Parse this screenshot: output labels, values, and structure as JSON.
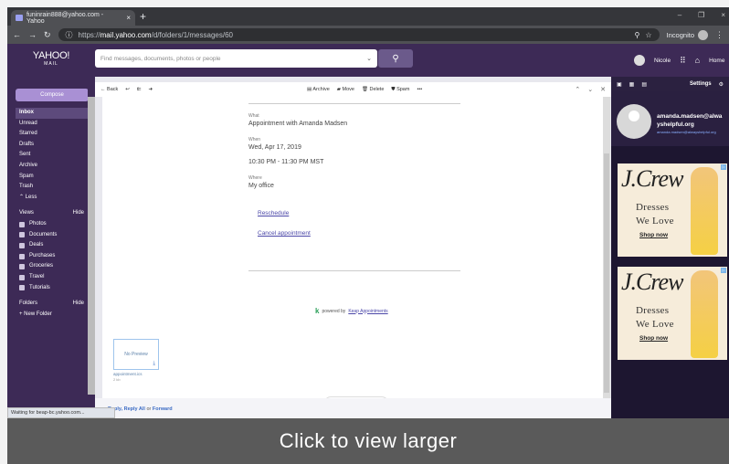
{
  "browser": {
    "tab_title": "funinrain888@yahoo.com - Yahoo",
    "tab_close": "×",
    "new_tab": "+",
    "window_controls": [
      "–",
      "❐",
      "×"
    ],
    "url_prefix": "https://",
    "url_host": "mail.yahoo.com",
    "url_path": "/d/folders/1/messages/60",
    "incognito_label": "Incognito"
  },
  "header": {
    "logo_line1": "YAHOO!",
    "logo_line2": "MAIL",
    "search_placeholder": "Find messages, documents, photos or people",
    "user_name": "Nicole",
    "home_label": "Home"
  },
  "sidebar": {
    "compose_label": "Compose",
    "folders_nav": [
      "Inbox",
      "Unread",
      "Starred",
      "Drafts",
      "Sent",
      "Archive",
      "Spam",
      "Trash",
      "⌃ Less"
    ],
    "views_label": "Views",
    "views_hide": "Hide",
    "views": [
      "Photos",
      "Documents",
      "Deals",
      "Purchases",
      "Groceries",
      "Travel",
      "Tutorials"
    ],
    "folders_label": "Folders",
    "folders_hide": "Hide",
    "new_folder": "+ New Folder"
  },
  "toolbar": {
    "back": "← Back",
    "archive": "Archive",
    "move": "Move",
    "delete": "Delete",
    "spam": "Spam",
    "more": "•••"
  },
  "message": {
    "what_label": "What",
    "what_value": "Appointment with Amanda Madsen",
    "when_label": "When",
    "when_date": "Wed, Apr 17, 2019",
    "when_time": "10:30 PM - 11:30 PM MST",
    "where_label": "Where",
    "where_value": "My office",
    "reschedule": "Reschedule",
    "cancel": "Cancel appointment",
    "powered_by": "powered by",
    "powered_link": "Keap Appointments",
    "attachment_preview": "No Preview",
    "attachment_name": "appointment.ics",
    "attachment_size": "2 kb",
    "reply_links": "Reply, Reply All",
    "reply_or": "or",
    "reply_forward": "Forward"
  },
  "right_pane": {
    "settings": "Settings",
    "contact_name_1": "amanda.madsen@alwa",
    "contact_name_2": "yshelpful.org",
    "contact_email": "amanda.madsen@alwayshelpful.org",
    "ad_brand": "J.Crew",
    "ad_line1": "Dresses",
    "ad_line2": "We Love",
    "ad_cta": "Shop now"
  },
  "status_bar": "Waiting for beap-bc.yahoo.com...",
  "overlay_text": "Click to view larger",
  "colors": {
    "yahoo_purple": "#3d2a56",
    "compose": "#a990d4",
    "link": "#4b47a8"
  }
}
